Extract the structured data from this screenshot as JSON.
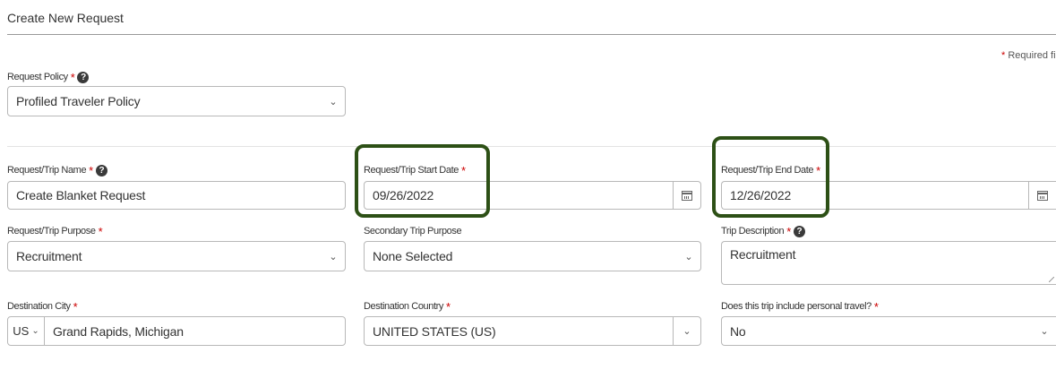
{
  "page_title": "Create New Request",
  "required_note": "Required field",
  "required_mark": "*",
  "help_glyph": "?",
  "chevron_glyph": "⌄",
  "highlight_color": "#2d5016",
  "required_color": "#cc0000",
  "fields": {
    "request_policy": {
      "label": "Request Policy",
      "value": "Profiled Traveler Policy"
    },
    "trip_name": {
      "label": "Request/Trip Name",
      "value": "Create Blanket Request"
    },
    "start_date": {
      "label": "Request/Trip Start Date",
      "value": "09/26/2022"
    },
    "end_date": {
      "label": "Request/Trip End Date",
      "value": "12/26/2022"
    },
    "trip_purpose": {
      "label": "Request/Trip Purpose",
      "value": "Recruitment"
    },
    "secondary_purpose": {
      "label": "Secondary Trip Purpose",
      "value": "None Selected"
    },
    "trip_description": {
      "label": "Trip Description",
      "value": "Recruitment"
    },
    "destination_city": {
      "label": "Destination City",
      "country_code": "US",
      "value": "Grand Rapids, Michigan"
    },
    "destination_country": {
      "label": "Destination Country",
      "value": "UNITED STATES (US)"
    },
    "personal_travel": {
      "label": "Does this trip include personal travel?",
      "value": "No"
    }
  }
}
